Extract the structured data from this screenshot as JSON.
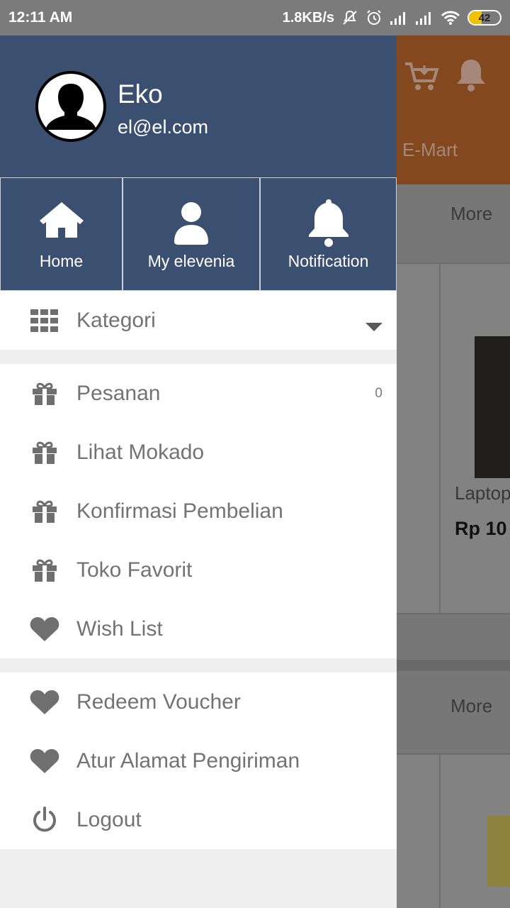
{
  "status_bar": {
    "time": "12:11 AM",
    "network_speed": "1.8KB/s",
    "battery_level": "42",
    "battery_fraction": 0.42,
    "icons": [
      "mute-icon",
      "alarm-icon",
      "signal-icon",
      "signal-icon",
      "wifi-icon",
      "battery-icon"
    ]
  },
  "profile": {
    "name": "Eko",
    "email": "el@el.com"
  },
  "quick_actions": [
    {
      "label": "Home",
      "icon": "home-icon"
    },
    {
      "label": "My elevenia",
      "icon": "user-icon"
    },
    {
      "label": "Notification",
      "icon": "bell-icon"
    }
  ],
  "category": {
    "label": "Kategori",
    "icon": "grid-icon"
  },
  "menu_main": [
    {
      "label": "Pesanan",
      "icon": "gift-icon",
      "count": "0"
    },
    {
      "label": "Lihat Mokado",
      "icon": "gift-icon"
    },
    {
      "label": "Konfirmasi Pembelian",
      "icon": "gift-icon"
    },
    {
      "label": "Toko Favorit",
      "icon": "gift-icon"
    },
    {
      "label": "Wish List",
      "icon": "heart-icon"
    }
  ],
  "menu_account": [
    {
      "label": "Redeem Voucher",
      "icon": "heart-icon"
    },
    {
      "label": "Atur Alamat Pengiriman",
      "icon": "heart-icon"
    },
    {
      "label": "Logout",
      "icon": "power-icon"
    }
  ],
  "background_app": {
    "brand_label": "E-Mart",
    "more_label_1": "More",
    "more_label_2": "More",
    "product_title": "Laptop",
    "product_price": "Rp 10"
  },
  "colors": {
    "drawer_header": "#3b5070",
    "menu_text": "#737373",
    "menu_icon": "#6f6f6f",
    "app_bar": "#e8731f"
  }
}
